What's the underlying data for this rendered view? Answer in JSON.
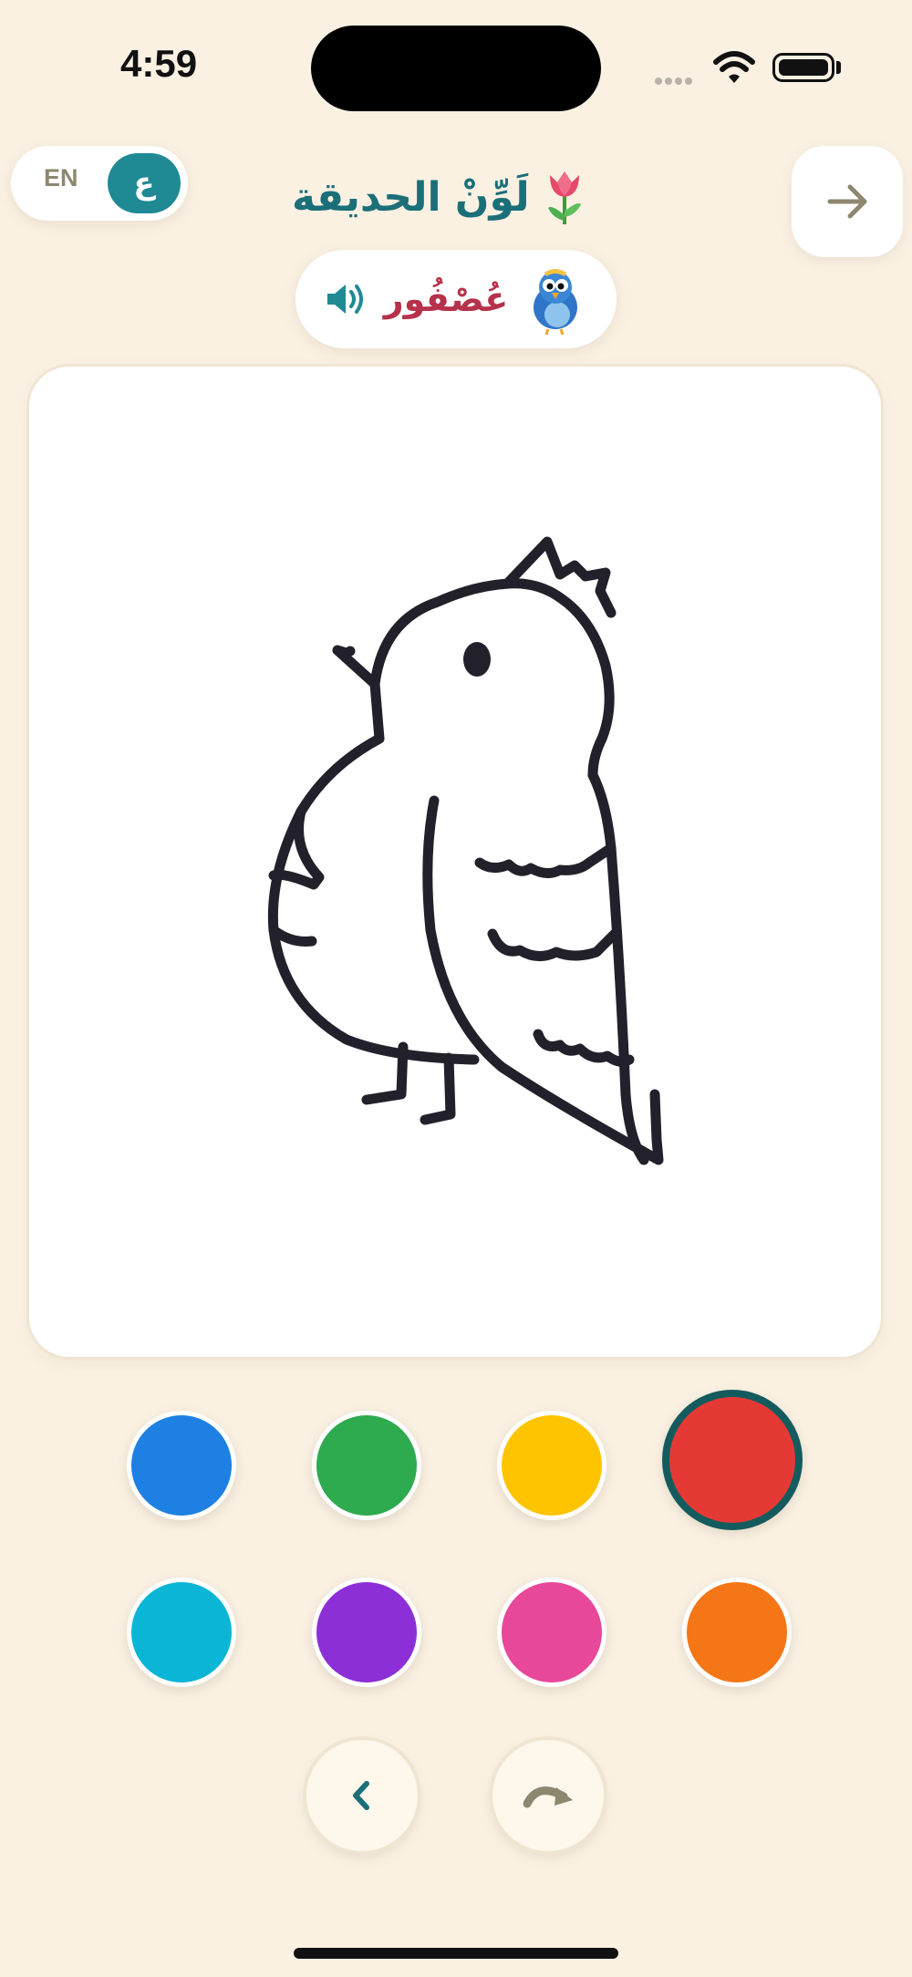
{
  "status_bar": {
    "time": "4:59"
  },
  "header": {
    "lang_toggle": {
      "en_label": "EN",
      "ar_label": "ع",
      "selected": "ar"
    },
    "title": "لَوِّنْ الحديقة",
    "title_emoji": "🌷",
    "next_button_icon": "arrow-right-icon"
  },
  "word_chip": {
    "word": "عُصْفُور",
    "mascot_icon": "bird-mascot-icon",
    "speaker_icon": "speaker-icon"
  },
  "canvas": {
    "drawing": "bird-outline"
  },
  "palette": {
    "selected_color": "#E53935",
    "colors": [
      "#1E80E3",
      "#2EAA4F",
      "#FFC400",
      "#E53935",
      "#0BB5D6",
      "#8D2FD6",
      "#E8489A",
      "#F57616"
    ]
  },
  "controls": {
    "undo_icon": "chevron-left-icon",
    "redo_icon": "redo-icon"
  },
  "colors": {
    "accent": "#1F8A94",
    "title": "#1B6F78",
    "word": "#B6324B",
    "background": "#FAF1E3"
  }
}
